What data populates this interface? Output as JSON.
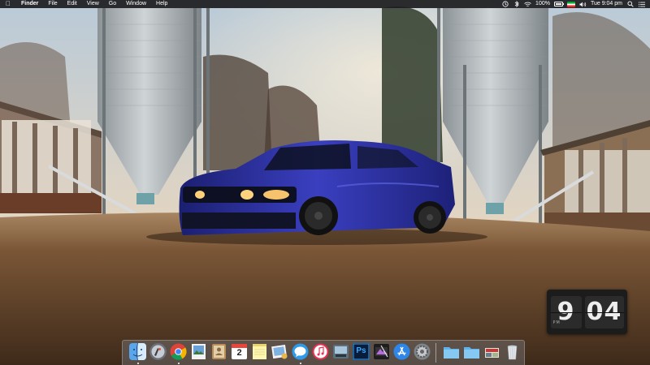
{
  "menubar": {
    "app_name": "Finder",
    "menus": [
      "File",
      "Edit",
      "View",
      "Go",
      "Window",
      "Help"
    ],
    "battery_text": "100%",
    "clock_text": "Tue 9:04 pm"
  },
  "clock_widget": {
    "hour": "9",
    "minute": "04",
    "ampm": "PM"
  },
  "dock": {
    "calendar_day": "2",
    "apps": [
      {
        "name": "finder-dock-icon"
      },
      {
        "name": "launchpad-dock-icon"
      },
      {
        "name": "chrome-dock-icon"
      },
      {
        "name": "preview-dock-icon"
      },
      {
        "name": "contacts-dock-icon"
      },
      {
        "name": "calendar-dock-icon"
      },
      {
        "name": "notes-dock-icon"
      },
      {
        "name": "photos-dock-icon"
      },
      {
        "name": "messages-dock-icon"
      },
      {
        "name": "itunes-dock-icon"
      },
      {
        "name": "image-capture-dock-icon"
      },
      {
        "name": "photoshop-dock-icon"
      },
      {
        "name": "final-cut-dock-icon"
      },
      {
        "name": "app-store-dock-icon"
      },
      {
        "name": "system-preferences-dock-icon"
      },
      {
        "name": "folder-dock-icon"
      },
      {
        "name": "downloads-folder-dock-icon"
      },
      {
        "name": "documents-stack-dock-icon"
      },
      {
        "name": "trash-dock-icon"
      }
    ],
    "photoshop_label": "Ps"
  },
  "colors": {
    "car_body": "#2b2f9a",
    "sky": "#c9d6df",
    "ground": "#6b4a2c",
    "silo": "#a7adb1"
  }
}
